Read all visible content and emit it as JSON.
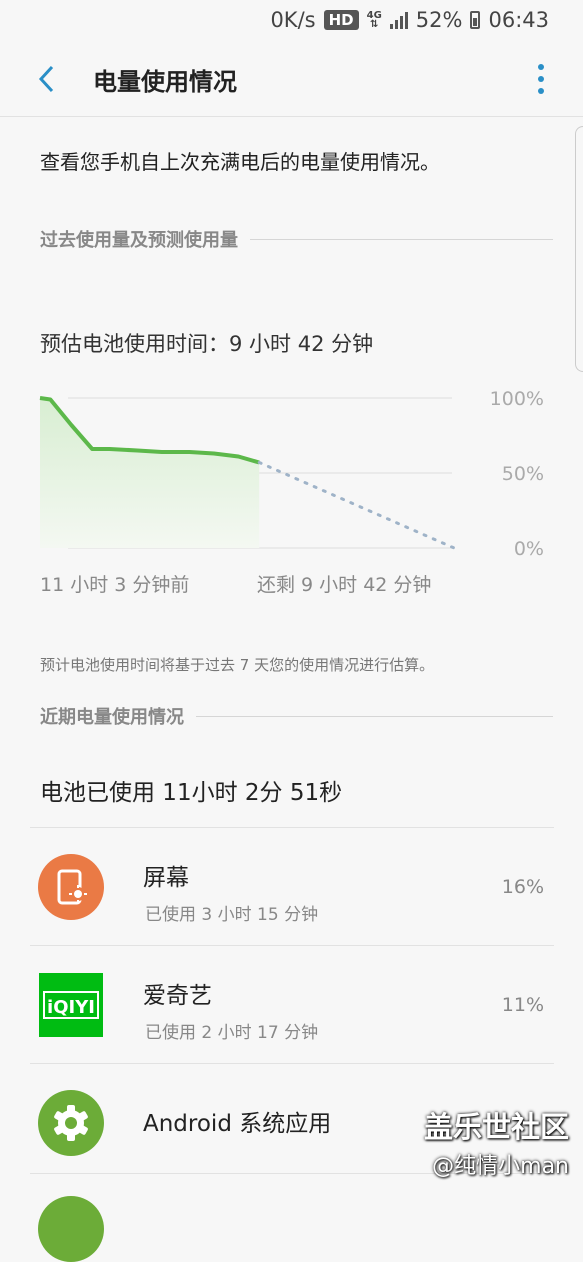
{
  "status_bar": {
    "net_speed": "0K/s",
    "hd": "HD",
    "net_type": "4G",
    "battery": "52%",
    "time": "06:43"
  },
  "app_bar": {
    "title": "电量使用情况"
  },
  "intro": "查看您手机自上次充满电后的电量使用情况。",
  "section_history": "过去使用量及预测使用量",
  "estimate": "预估电池使用时间：9 小时 42 分钟",
  "chart_data": {
    "type": "area",
    "y_tick_labels": [
      "100%",
      "50%",
      "0%"
    ],
    "ylim": [
      0,
      100
    ],
    "x_labels": [
      "11 小时 3 分钟前",
      "还剩 9 小时 42 分钟"
    ],
    "series": [
      {
        "values": [
          [
            0,
            100
          ],
          [
            3,
            99
          ],
          [
            9,
            82
          ],
          [
            15,
            66
          ],
          [
            20,
            66
          ],
          [
            28,
            65
          ],
          [
            35,
            64
          ],
          [
            43,
            64
          ],
          [
            50,
            63
          ],
          [
            57,
            61
          ],
          [
            63,
            57
          ]
        ]
      },
      {
        "values": [
          [
            63,
            57
          ],
          [
            119,
            0
          ]
        ]
      }
    ],
    "colors": {
      "history": "#5cb84a",
      "fill": "#e3f2df",
      "forecast": "#9fb3c8",
      "grid": "#dedede"
    }
  },
  "note": "预计电池使用时间将基于过去 7 天您的使用情况进行估算。",
  "section_recent": "近期电量使用情况",
  "battery_used": "电池已使用 11小时 2分 51秒",
  "apps": [
    {
      "name": "屏幕",
      "usage": "已使用 3 小时 15 分钟",
      "percent": "16%",
      "icon": "screen-icon",
      "color": "#ea7a45"
    },
    {
      "name": "爱奇艺",
      "usage": "已使用 2 小时 17 分钟",
      "percent": "11%",
      "icon": "iqiyi-logo",
      "logo_text": "iQIYI",
      "color": "#00bc12"
    },
    {
      "name": "Android 系统应用",
      "usage": "",
      "percent": "",
      "icon": "gear-icon",
      "color": "#6cac38"
    }
  ],
  "watermark": {
    "line1": "盖乐世社区",
    "line2": "@纯情小man"
  }
}
